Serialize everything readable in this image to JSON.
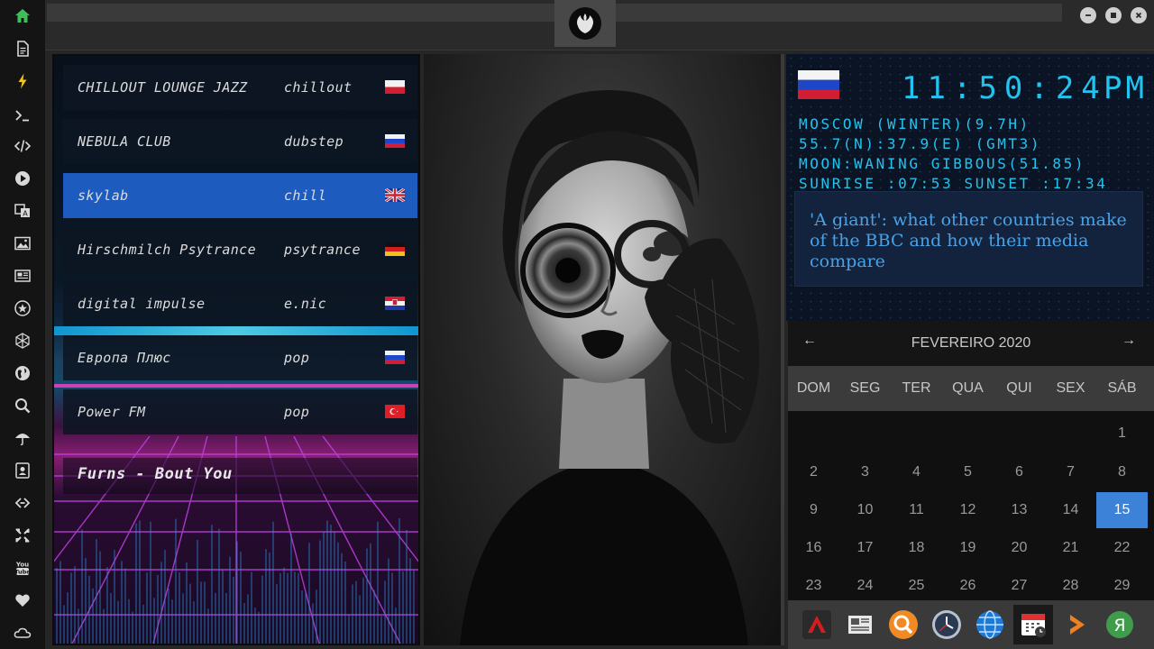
{
  "sidebar": {
    "items": [
      {
        "icon": "home-icon"
      },
      {
        "icon": "document-icon"
      },
      {
        "icon": "lightning-icon"
      },
      {
        "icon": "terminal-icon"
      },
      {
        "icon": "code-icon"
      },
      {
        "icon": "play-icon"
      },
      {
        "icon": "translate-icon"
      },
      {
        "icon": "image-icon"
      },
      {
        "icon": "newspaper-icon"
      },
      {
        "icon": "star-badge-icon"
      },
      {
        "icon": "hexagon-icon"
      },
      {
        "icon": "globe-icon"
      },
      {
        "icon": "search-icon"
      },
      {
        "icon": "umbrella-icon"
      },
      {
        "icon": "contact-card-icon"
      },
      {
        "icon": "link-icon"
      },
      {
        "icon": "expand-icon"
      },
      {
        "icon": "youtube-icon"
      },
      {
        "icon": "heart-icon"
      },
      {
        "icon": "cloud-icon"
      }
    ],
    "active_color": "#3fbf5a"
  },
  "window": {
    "logo_icon": "rebel-alliance-icon"
  },
  "radio": {
    "stations": [
      {
        "name": "CHILLOUT LOUNGE JAZZ",
        "genre": "chillout",
        "flag": "poland-flag-icon"
      },
      {
        "name": "NEBULA CLUB",
        "genre": "dubstep",
        "flag": "russia-flag-icon"
      },
      {
        "name": "skylab",
        "genre": "chill",
        "flag": "uk-flag-icon"
      },
      {
        "name": "Hirschmilch Psytrance",
        "genre": "psytrance",
        "flag": "germany-flag-icon"
      },
      {
        "name": "digital impulse",
        "genre": "e.nic",
        "flag": "croatia-flag-icon"
      },
      {
        "name": "Европа Плюс",
        "genre": "pop",
        "flag": "russia-flag-icon"
      },
      {
        "name": "Power FM",
        "genre": "pop",
        "flag": "turkey-flag-icon"
      }
    ],
    "active_index": 2,
    "now_playing": "Furns - Bout You",
    "accent": "#1d5bbf"
  },
  "clock": {
    "flag": "russia-flag-icon",
    "time": "11:50:24",
    "ampm": "PM",
    "location": "MOSCOW (WINTER)(9.7H)",
    "coords": "55.7(N):37.9(E) (GMT3)",
    "moon": "MOON:WANING GIBBOUS(51.85)",
    "sun": "SUNRISE_:07:53 SUNSET_:17:34",
    "color": "#22c3ee"
  },
  "news": {
    "headline": "'A giant': what other countries make of the BBC and how their media compare"
  },
  "calendar": {
    "month_label": "FEVEREIRO 2020",
    "weekdays": [
      "DOM",
      "SEG",
      "TER",
      "QUA",
      "QUI",
      "SEX",
      "SÁB"
    ],
    "rows": [
      [
        "",
        "",
        "",
        "",
        "",
        "",
        "1"
      ],
      [
        "2",
        "3",
        "4",
        "5",
        "6",
        "7",
        "8"
      ],
      [
        "9",
        "10",
        "11",
        "12",
        "13",
        "14",
        "15"
      ],
      [
        "16",
        "17",
        "18",
        "19",
        "20",
        "21",
        "22"
      ],
      [
        "23",
        "24",
        "25",
        "26",
        "27",
        "28",
        "29"
      ]
    ],
    "today": "15",
    "today_color": "#3b82d8"
  },
  "dock": {
    "items": [
      {
        "icon": "red-triangle-app-icon"
      },
      {
        "icon": "news-reader-icon"
      },
      {
        "icon": "magnifier-app-icon"
      },
      {
        "icon": "clock-app-icon"
      },
      {
        "icon": "globe-browser-icon"
      },
      {
        "icon": "calendar-app-icon"
      },
      {
        "icon": "play-arrow-app-icon"
      },
      {
        "icon": "yandex-icon"
      }
    ],
    "active_index": 5
  }
}
